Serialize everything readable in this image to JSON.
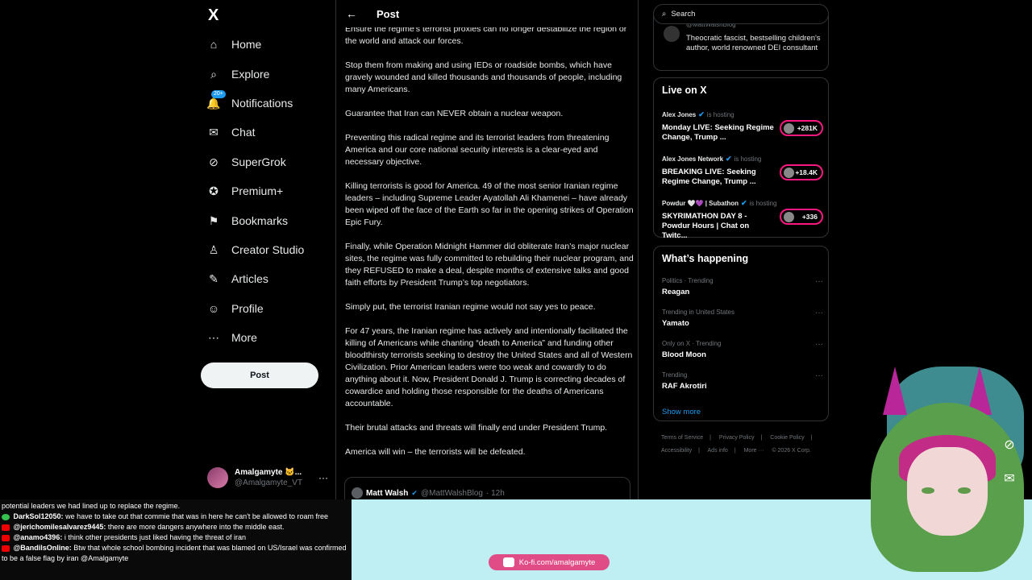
{
  "nav": {
    "logo": "X",
    "items": [
      {
        "label": "Home",
        "icon": "home-icon",
        "glyph": "⌂"
      },
      {
        "label": "Explore",
        "icon": "search-icon",
        "glyph": "⌕"
      },
      {
        "label": "Notifications",
        "icon": "bell-icon",
        "glyph": "🔔",
        "badge": "20+"
      },
      {
        "label": "Chat",
        "icon": "mail-icon",
        "glyph": "✉"
      },
      {
        "label": "SuperGrok",
        "icon": "grok-icon",
        "glyph": "⊘"
      },
      {
        "label": "Premium+",
        "icon": "premium-icon",
        "glyph": "✪"
      },
      {
        "label": "Bookmarks",
        "icon": "bookmark-icon",
        "glyph": "⚑"
      },
      {
        "label": "Creator Studio",
        "icon": "creator-icon",
        "glyph": "♙"
      },
      {
        "label": "Articles",
        "icon": "articles-icon",
        "glyph": "✎"
      },
      {
        "label": "Profile",
        "icon": "profile-icon",
        "glyph": "☺"
      },
      {
        "label": "More",
        "icon": "more-icon",
        "glyph": "⋯"
      }
    ],
    "post_button": "Post",
    "account": {
      "name": "Amalgamyte 🐱...",
      "handle": "@Amalgamyte_VT",
      "more": "···"
    }
  },
  "main": {
    "header_title": "Post",
    "paragraphs": [
      "Ensure the regime's terrorist proxies can no longer destabilize the region or the world and attack our forces.",
      "Stop them from making and using IEDs or roadside bombs, which have gravely wounded and killed thousands and thousands of people, including many Americans.",
      "Guarantee that Iran can NEVER obtain a nuclear weapon.",
      "Preventing this radical regime and its terrorist leaders from threatening America and our core national security interests is a clear-eyed and necessary objective.",
      "Killing terrorists is good for America. 49 of the most senior Iranian regime leaders – including Supreme Leader Ayatollah Ali Khamenei – have already been wiped off the face of the Earth so far in the opening strikes of Operation Epic Fury.",
      "Finally, while Operation Midnight Hammer did obliterate Iran’s major nuclear sites, the regime was fully committed to rebuilding their nuclear program, and they REFUSED to make a deal, despite months of extensive talks and good faith efforts by President Trump’s top negotiators.",
      "Simply put, the terrorist Iranian regime would not say yes to peace.",
      "For 47 years, the Iranian regime has actively and intentionally facilitated the killing of Americans while chanting “death to America” and funding other bloodthirsty terrorists seeking to destroy the United States and all of Western Civilization. Prior American leaders were too weak and cowardly to do anything about it. Now, President Donald J. Trump is correcting decades of cowardice and holding those responsible for the deaths of Americans accountable.",
      "Their brutal attacks and threats will finally end under President Trump.",
      "America will win – the terrorists will be defeated."
    ],
    "quote": {
      "name": "Matt Walsh",
      "handle": "@MattWalshBlog",
      "time": "· 12h"
    }
  },
  "right": {
    "search_placeholder": "Search",
    "follow": {
      "handle": "@MattWalshBlog",
      "bio": "Theocratic fascist, bestselling children's author, world renowned DEI consultant"
    },
    "live": {
      "title": "Live on X",
      "items": [
        {
          "host": "Alex Jones",
          "hosting": "is hosting",
          "title": "Monday LIVE: Seeking Regime Change, Trump ...",
          "count": "+281K"
        },
        {
          "host": "Alex Jones Network",
          "hosting": "is hosting",
          "title": "BREAKING LIVE: Seeking Regime Change, Trump ...",
          "count": "+18.4K"
        },
        {
          "host": "Powdur 🤍💜 | Subathon",
          "hosting": "is hosting",
          "title": "SKYRIMATHON DAY 8 - Powdur Hours | Chat on Twitc...",
          "count": "+336"
        }
      ]
    },
    "happening": {
      "title": "What’s happening",
      "trends": [
        {
          "meta": "Politics · Trending",
          "name": "Reagan"
        },
        {
          "meta": "Trending in United States",
          "name": "Yamato"
        },
        {
          "meta": "Only on X · Trending",
          "name": "Blood Moon"
        },
        {
          "meta": "Trending",
          "name": "RAF Akrotiri"
        }
      ],
      "show_more": "Show more"
    },
    "footer": [
      "Terms of Service",
      "|",
      "Privacy Policy",
      "|",
      "Cookie Policy",
      "|",
      "Accessibility",
      "|",
      "Ads info",
      "|",
      "More ···",
      "© 2026 X Corp."
    ]
  },
  "chat": [
    {
      "user": "",
      "text": "potential leaders we had lined up to replace the regime."
    },
    {
      "user": "DarkSol12050:",
      "text": " we have to take out that commie that was in here he can't be allowed to roam free"
    },
    {
      "user": "@jericho­milesalvarez9445:",
      "text": " there are more dangers anywhere into the middle east."
    },
    {
      "user": "@anamo4396:",
      "text": " i think other presidents just liked having the threat of iran"
    },
    {
      "user": "@BandilsOnline:",
      "text": " Btw that whole school bombing incident that was blamed on US/Israel was confirmed to be a false flag by iran @Amalgamyte"
    }
  ],
  "kofi": "Ko-fi.com/amalgamyte",
  "colors": {
    "accent": "#1d9bf0",
    "live": "#f91880",
    "kofi": "#e04c86",
    "overlay": "#bfeef3"
  }
}
